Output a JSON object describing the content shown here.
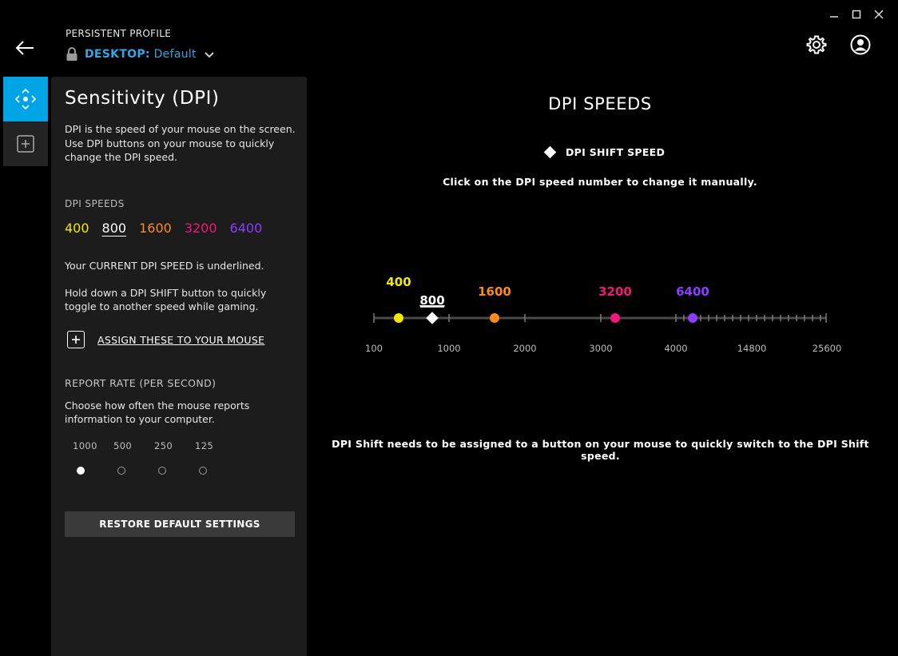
{
  "profile": {
    "label": "PERSISTENT PROFILE",
    "prefix": "DESKTOP:",
    "name": "Default"
  },
  "panel": {
    "title": "Sensitivity (DPI)",
    "description": "DPI is the speed of your mouse on the screen. Use DPI buttons on your mouse to quickly change the DPI speed.",
    "dpi_label": "DPI SPEEDS",
    "dpi_speeds": [
      {
        "value": "400",
        "color": "#f4e700"
      },
      {
        "value": "800",
        "color": "#ffffff",
        "current": true
      },
      {
        "value": "1600",
        "color": "#ff8a1c"
      },
      {
        "value": "3200",
        "color": "#f0187a"
      },
      {
        "value": "6400",
        "color": "#8c3cff"
      }
    ],
    "current_note": "Your CURRENT DPI SPEED is underlined.",
    "shift_note": "Hold down a DPI SHIFT button to quickly toggle to another speed while gaming.",
    "assign_label": "ASSIGN THESE TO YOUR MOUSE",
    "report_rate_label": "REPORT RATE (PER SECOND)",
    "report_rate_desc": "Choose how often the mouse reports information to your computer.",
    "report_rates": [
      "1000",
      "500",
      "250",
      "125"
    ],
    "report_rate_selected": "1000",
    "restore_label": "RESTORE DEFAULT SETTINGS"
  },
  "main": {
    "title": "DPI SPEEDS",
    "shift_legend": "DPI SHIFT SPEED",
    "click_hint": "Click on the DPI speed number to change it manually.",
    "axis_labels": [
      "100",
      "1000",
      "2000",
      "3000",
      "4000",
      "14800",
      "25600"
    ],
    "shift_speed": "800",
    "dpi_shift_note": "DPI Shift needs to be assigned to a button on your mouse to quickly switch to the DPI Shift speed."
  },
  "colors": {
    "accent": "#00a4e4",
    "profile_blue": "#2ea8e6",
    "panel_bg": "#1c1c1c"
  }
}
